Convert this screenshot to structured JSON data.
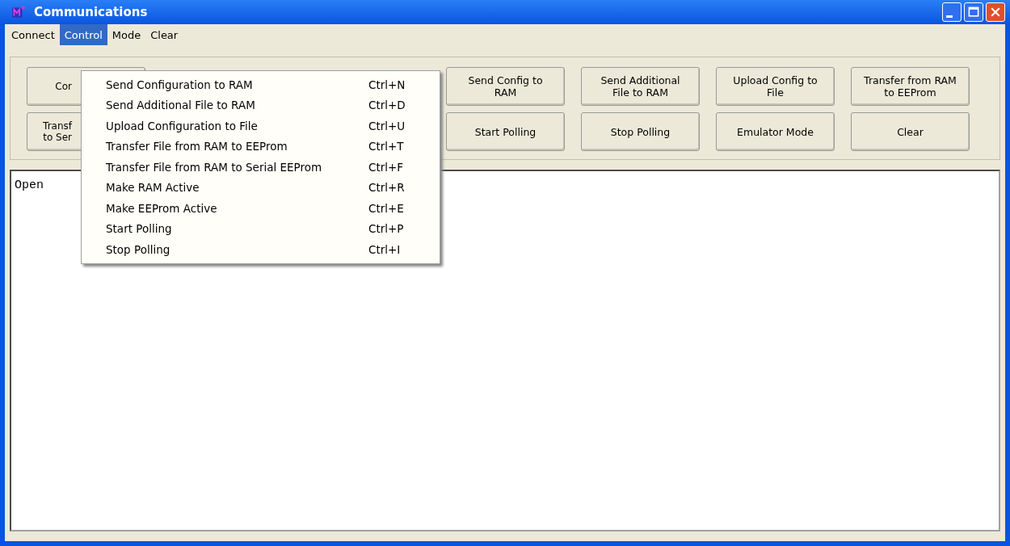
{
  "window": {
    "title": "Communications"
  },
  "menu_bar": [
    {
      "label": "Connect",
      "selected": false
    },
    {
      "label": "Control",
      "selected": true
    },
    {
      "label": "Mode",
      "selected": false
    },
    {
      "label": "Clear",
      "selected": false
    }
  ],
  "buttons_row_1": {
    "left": [
      "Cor"
    ],
    "right": [
      [
        "Send Config to",
        "RAM"
      ],
      [
        "Send Additional",
        "File to RAM"
      ],
      [
        "Upload Config to",
        "File"
      ],
      [
        "Transfer from RAM",
        "to EEProm"
      ]
    ]
  },
  "buttons_row_2": {
    "left": [
      "Transf",
      "to Ser"
    ],
    "right": [
      [
        "Start Polling"
      ],
      [
        "Stop Polling"
      ],
      [
        "Emulator Mode"
      ],
      [
        "Clear"
      ]
    ]
  },
  "output": {
    "text": "Open"
  },
  "control_menu": [
    {
      "label": "Send Configuration to RAM",
      "shortcut": "Ctrl+N"
    },
    {
      "label": "Send Additional File to RAM",
      "shortcut": "Ctrl+D"
    },
    {
      "label": "Upload Configuration to File",
      "shortcut": "Ctrl+U"
    },
    {
      "label": "Transfer File from RAM to EEProm",
      "shortcut": "Ctrl+T"
    },
    {
      "label": "Transfer File from RAM to Serial EEProm",
      "shortcut": "Ctrl+F"
    },
    {
      "label": "Make RAM Active",
      "shortcut": "Ctrl+R"
    },
    {
      "label": "Make EEProm Active",
      "shortcut": "Ctrl+E"
    },
    {
      "label": "Start Polling",
      "shortcut": "Ctrl+P"
    },
    {
      "label": "Stop Polling",
      "shortcut": "Ctrl+I"
    }
  ]
}
